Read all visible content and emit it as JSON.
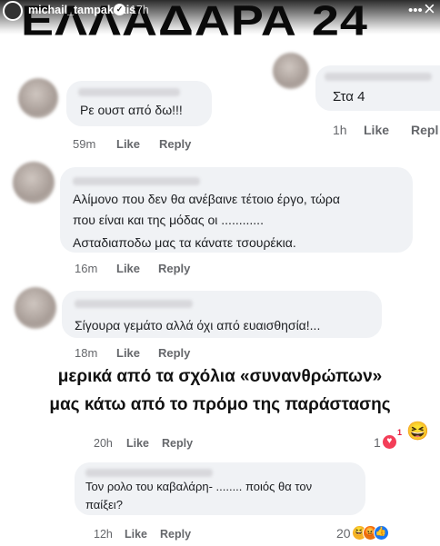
{
  "story": {
    "username": "michail_tampakakis",
    "time": "17h",
    "banner": "ΕΛΛΑΔΑΡΑ 24"
  },
  "comments": [
    {
      "text": "Ρε ουστ από δω!!!",
      "time": "59m",
      "like": "Like",
      "reply": "Reply"
    },
    {
      "text": "Στα 4",
      "time": "1h",
      "like": "Like",
      "reply": "Repl"
    },
    {
      "lines": [
        "Αλίμονο που δεν θα ανέβαινε τέτοιο έργο, τώρα",
        "που είναι και της μόδας οι ............",
        "Ασταδιαποδω μας τα κάνατε τσουρέκια."
      ],
      "time": "16m",
      "like": "Like",
      "reply": "Reply"
    },
    {
      "text": "Σίγουρα γεμάτο αλλά όχι από ευαισθησία!...",
      "time": "18m",
      "like": "Like",
      "reply": "Reply"
    },
    {
      "time": "20h",
      "like": "Like",
      "reply": "Reply",
      "reactions": "1",
      "reaction_badge": "1"
    },
    {
      "lines": [
        "Τον ρολο του καβαλάρη- ........ ποιός θα τον",
        "παίξει?"
      ],
      "time": "12h",
      "like": "Like",
      "reply": "Reply",
      "reactions": "20"
    }
  ],
  "caption": {
    "line1": "μερικά από τα σχόλια «συνανθρώπων»",
    "line2": "μας κάτω από το πρόμο της παράστασης"
  },
  "icons": {
    "laugh": "laughing-emoji-icon",
    "heart": "heart-reaction-icon",
    "haha": "haha-reaction-icon",
    "angry": "angry-reaction-icon",
    "like": "like-reaction-icon",
    "verified": "verified-badge-icon",
    "more": "more-icon",
    "close": "close-icon"
  }
}
